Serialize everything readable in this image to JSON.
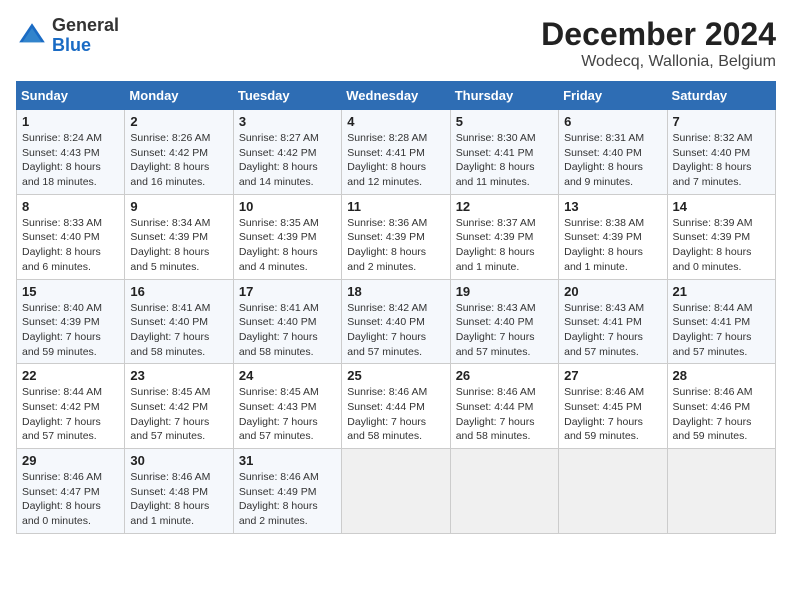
{
  "logo": {
    "general": "General",
    "blue": "Blue"
  },
  "title": "December 2024",
  "subtitle": "Wodecq, Wallonia, Belgium",
  "days_header": [
    "Sunday",
    "Monday",
    "Tuesday",
    "Wednesday",
    "Thursday",
    "Friday",
    "Saturday"
  ],
  "weeks": [
    [
      {
        "day": "1",
        "sunrise": "Sunrise: 8:24 AM",
        "sunset": "Sunset: 4:43 PM",
        "daylight": "Daylight: 8 hours and 18 minutes."
      },
      {
        "day": "2",
        "sunrise": "Sunrise: 8:26 AM",
        "sunset": "Sunset: 4:42 PM",
        "daylight": "Daylight: 8 hours and 16 minutes."
      },
      {
        "day": "3",
        "sunrise": "Sunrise: 8:27 AM",
        "sunset": "Sunset: 4:42 PM",
        "daylight": "Daylight: 8 hours and 14 minutes."
      },
      {
        "day": "4",
        "sunrise": "Sunrise: 8:28 AM",
        "sunset": "Sunset: 4:41 PM",
        "daylight": "Daylight: 8 hours and 12 minutes."
      },
      {
        "day": "5",
        "sunrise": "Sunrise: 8:30 AM",
        "sunset": "Sunset: 4:41 PM",
        "daylight": "Daylight: 8 hours and 11 minutes."
      },
      {
        "day": "6",
        "sunrise": "Sunrise: 8:31 AM",
        "sunset": "Sunset: 4:40 PM",
        "daylight": "Daylight: 8 hours and 9 minutes."
      },
      {
        "day": "7",
        "sunrise": "Sunrise: 8:32 AM",
        "sunset": "Sunset: 4:40 PM",
        "daylight": "Daylight: 8 hours and 7 minutes."
      }
    ],
    [
      {
        "day": "8",
        "sunrise": "Sunrise: 8:33 AM",
        "sunset": "Sunset: 4:40 PM",
        "daylight": "Daylight: 8 hours and 6 minutes."
      },
      {
        "day": "9",
        "sunrise": "Sunrise: 8:34 AM",
        "sunset": "Sunset: 4:39 PM",
        "daylight": "Daylight: 8 hours and 5 minutes."
      },
      {
        "day": "10",
        "sunrise": "Sunrise: 8:35 AM",
        "sunset": "Sunset: 4:39 PM",
        "daylight": "Daylight: 8 hours and 4 minutes."
      },
      {
        "day": "11",
        "sunrise": "Sunrise: 8:36 AM",
        "sunset": "Sunset: 4:39 PM",
        "daylight": "Daylight: 8 hours and 2 minutes."
      },
      {
        "day": "12",
        "sunrise": "Sunrise: 8:37 AM",
        "sunset": "Sunset: 4:39 PM",
        "daylight": "Daylight: 8 hours and 1 minute."
      },
      {
        "day": "13",
        "sunrise": "Sunrise: 8:38 AM",
        "sunset": "Sunset: 4:39 PM",
        "daylight": "Daylight: 8 hours and 1 minute."
      },
      {
        "day": "14",
        "sunrise": "Sunrise: 8:39 AM",
        "sunset": "Sunset: 4:39 PM",
        "daylight": "Daylight: 8 hours and 0 minutes."
      }
    ],
    [
      {
        "day": "15",
        "sunrise": "Sunrise: 8:40 AM",
        "sunset": "Sunset: 4:39 PM",
        "daylight": "Daylight: 7 hours and 59 minutes."
      },
      {
        "day": "16",
        "sunrise": "Sunrise: 8:41 AM",
        "sunset": "Sunset: 4:40 PM",
        "daylight": "Daylight: 7 hours and 58 minutes."
      },
      {
        "day": "17",
        "sunrise": "Sunrise: 8:41 AM",
        "sunset": "Sunset: 4:40 PM",
        "daylight": "Daylight: 7 hours and 58 minutes."
      },
      {
        "day": "18",
        "sunrise": "Sunrise: 8:42 AM",
        "sunset": "Sunset: 4:40 PM",
        "daylight": "Daylight: 7 hours and 57 minutes."
      },
      {
        "day": "19",
        "sunrise": "Sunrise: 8:43 AM",
        "sunset": "Sunset: 4:40 PM",
        "daylight": "Daylight: 7 hours and 57 minutes."
      },
      {
        "day": "20",
        "sunrise": "Sunrise: 8:43 AM",
        "sunset": "Sunset: 4:41 PM",
        "daylight": "Daylight: 7 hours and 57 minutes."
      },
      {
        "day": "21",
        "sunrise": "Sunrise: 8:44 AM",
        "sunset": "Sunset: 4:41 PM",
        "daylight": "Daylight: 7 hours and 57 minutes."
      }
    ],
    [
      {
        "day": "22",
        "sunrise": "Sunrise: 8:44 AM",
        "sunset": "Sunset: 4:42 PM",
        "daylight": "Daylight: 7 hours and 57 minutes."
      },
      {
        "day": "23",
        "sunrise": "Sunrise: 8:45 AM",
        "sunset": "Sunset: 4:42 PM",
        "daylight": "Daylight: 7 hours and 57 minutes."
      },
      {
        "day": "24",
        "sunrise": "Sunrise: 8:45 AM",
        "sunset": "Sunset: 4:43 PM",
        "daylight": "Daylight: 7 hours and 57 minutes."
      },
      {
        "day": "25",
        "sunrise": "Sunrise: 8:46 AM",
        "sunset": "Sunset: 4:44 PM",
        "daylight": "Daylight: 7 hours and 58 minutes."
      },
      {
        "day": "26",
        "sunrise": "Sunrise: 8:46 AM",
        "sunset": "Sunset: 4:44 PM",
        "daylight": "Daylight: 7 hours and 58 minutes."
      },
      {
        "day": "27",
        "sunrise": "Sunrise: 8:46 AM",
        "sunset": "Sunset: 4:45 PM",
        "daylight": "Daylight: 7 hours and 59 minutes."
      },
      {
        "day": "28",
        "sunrise": "Sunrise: 8:46 AM",
        "sunset": "Sunset: 4:46 PM",
        "daylight": "Daylight: 7 hours and 59 minutes."
      }
    ],
    [
      {
        "day": "29",
        "sunrise": "Sunrise: 8:46 AM",
        "sunset": "Sunset: 4:47 PM",
        "daylight": "Daylight: 8 hours and 0 minutes."
      },
      {
        "day": "30",
        "sunrise": "Sunrise: 8:46 AM",
        "sunset": "Sunset: 4:48 PM",
        "daylight": "Daylight: 8 hours and 1 minute."
      },
      {
        "day": "31",
        "sunrise": "Sunrise: 8:46 AM",
        "sunset": "Sunset: 4:49 PM",
        "daylight": "Daylight: 8 hours and 2 minutes."
      },
      null,
      null,
      null,
      null
    ]
  ]
}
